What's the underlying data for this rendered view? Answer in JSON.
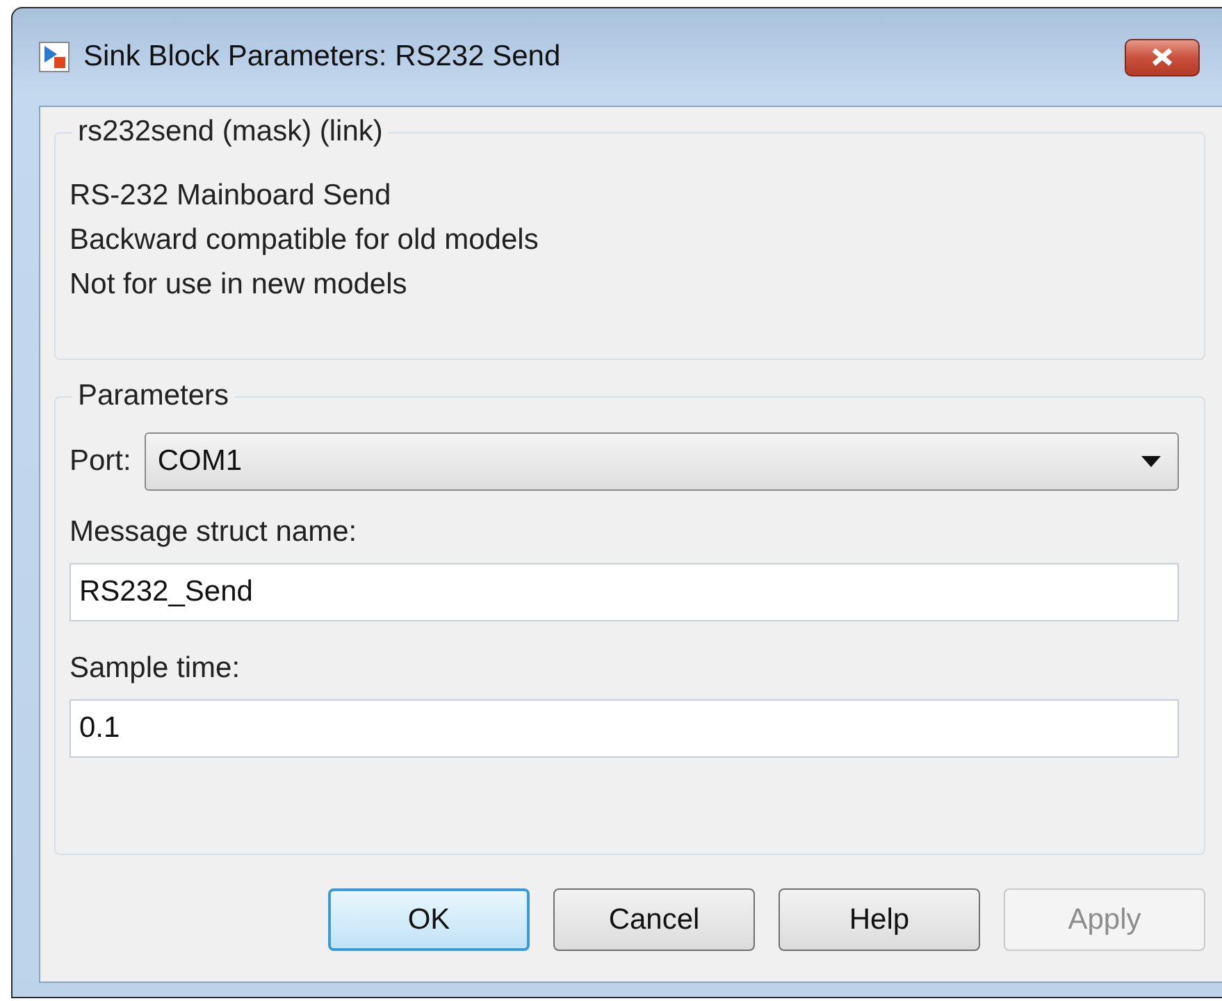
{
  "window": {
    "title": "Sink Block Parameters: RS232 Send"
  },
  "description": {
    "title": "rs232send (mask) (link)",
    "lines": [
      "RS-232 Mainboard Send",
      "Backward compatible for old models",
      "Not for use in new models"
    ]
  },
  "parameters": {
    "title": "Parameters",
    "fields": [
      {
        "kind": "dropdown",
        "label": "Port:",
        "value": "COM1"
      },
      {
        "kind": "text",
        "label": "Message struct name:",
        "value": "RS232_Send"
      },
      {
        "kind": "text",
        "label": "Sample time:",
        "value": "0.1"
      }
    ]
  },
  "buttons": [
    {
      "label": "OK",
      "default": true,
      "disabled": false
    },
    {
      "label": "Cancel",
      "default": false,
      "disabled": false
    },
    {
      "label": "Help",
      "default": false,
      "disabled": false
    },
    {
      "label": "Apply",
      "default": false,
      "disabled": true
    }
  ]
}
